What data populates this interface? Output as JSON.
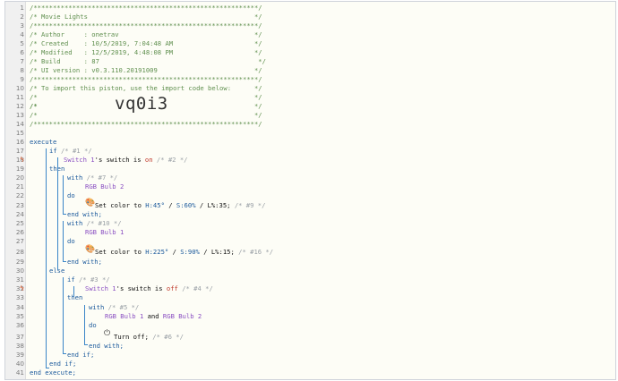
{
  "header_comment": {
    "rule": "/**********************************************************/",
    "title": "/* Movie Lights                                           */",
    "author": "/* Author     : onetrav                                   */",
    "created": "/* Created    : 10/5/2019, 7:04:48 AM                     */",
    "modified": "/* Modified   : 12/5/2019, 4:48:08 PM                     */",
    "build": "/* Build      : 87                                         */",
    "ui_version": "/* UI version : v0.3.110.20191009                         */",
    "import_note": "/* To import this piston, use the import code below:      */",
    "blank": "/*                                                        */",
    "code_prefix": "/*",
    "import_code": "vq0i3",
    "code_suffix": "*/"
  },
  "code": {
    "execute": "execute",
    "end_execute": "end execute;",
    "if": "if",
    "then": "then",
    "else": "else",
    "do": "do",
    "with": "with",
    "end_with": "end with;",
    "end_if": "end if;",
    "c1": "/* #1 */",
    "c2": "/* #2 */",
    "c3": "/* #3 */",
    "c4": "/* #4 */",
    "c5": "/* #5 */",
    "c6": "/* #6 */",
    "c7": "/* #7 */",
    "c9": "/* #9 */",
    "c10": "/* #10 */",
    "c16": "/* #16 */",
    "switch1": "Switch 1",
    "possessive": "'s",
    "switch_word": "switch",
    "is_word": "is",
    "on": "on",
    "off": "off",
    "bulb2": "RGB Bulb 2",
    "bulb1": "RGB Bulb 1",
    "and": "and",
    "set_color": "Set color to",
    "h45": "H:45°",
    "s60": "S:60%",
    "l35": "L%:35;",
    "h225": "H:225°",
    "s90": "S:90%",
    "l15": "L%:15;",
    "slash": "/",
    "turn_off": "Turn off;"
  },
  "line_numbers": [
    "1",
    "2",
    "3",
    "4",
    "5",
    "6",
    "7",
    "8",
    "9",
    "10",
    "11",
    "12",
    "13",
    "14",
    "15",
    "16",
    "17",
    "18",
    "19",
    "20",
    "21",
    "22",
    "23",
    "24",
    "25",
    "26",
    "27",
    "28",
    "29",
    "30",
    "31",
    "32",
    "33",
    "34",
    "35",
    "36",
    "37",
    "38",
    "39",
    "40",
    "41"
  ],
  "icons": {
    "trigger": "bolt-icon",
    "set_color": "palette-icon",
    "turn_off": "power-icon"
  },
  "colors": {
    "keyword": "#1c5a9c",
    "device": "#8a4fc2",
    "comment": "#9aa0a6",
    "header": "#5f8f4e",
    "value": "#c0392b",
    "bar": "#3b86c8",
    "trigger": "#e05a2b"
  }
}
